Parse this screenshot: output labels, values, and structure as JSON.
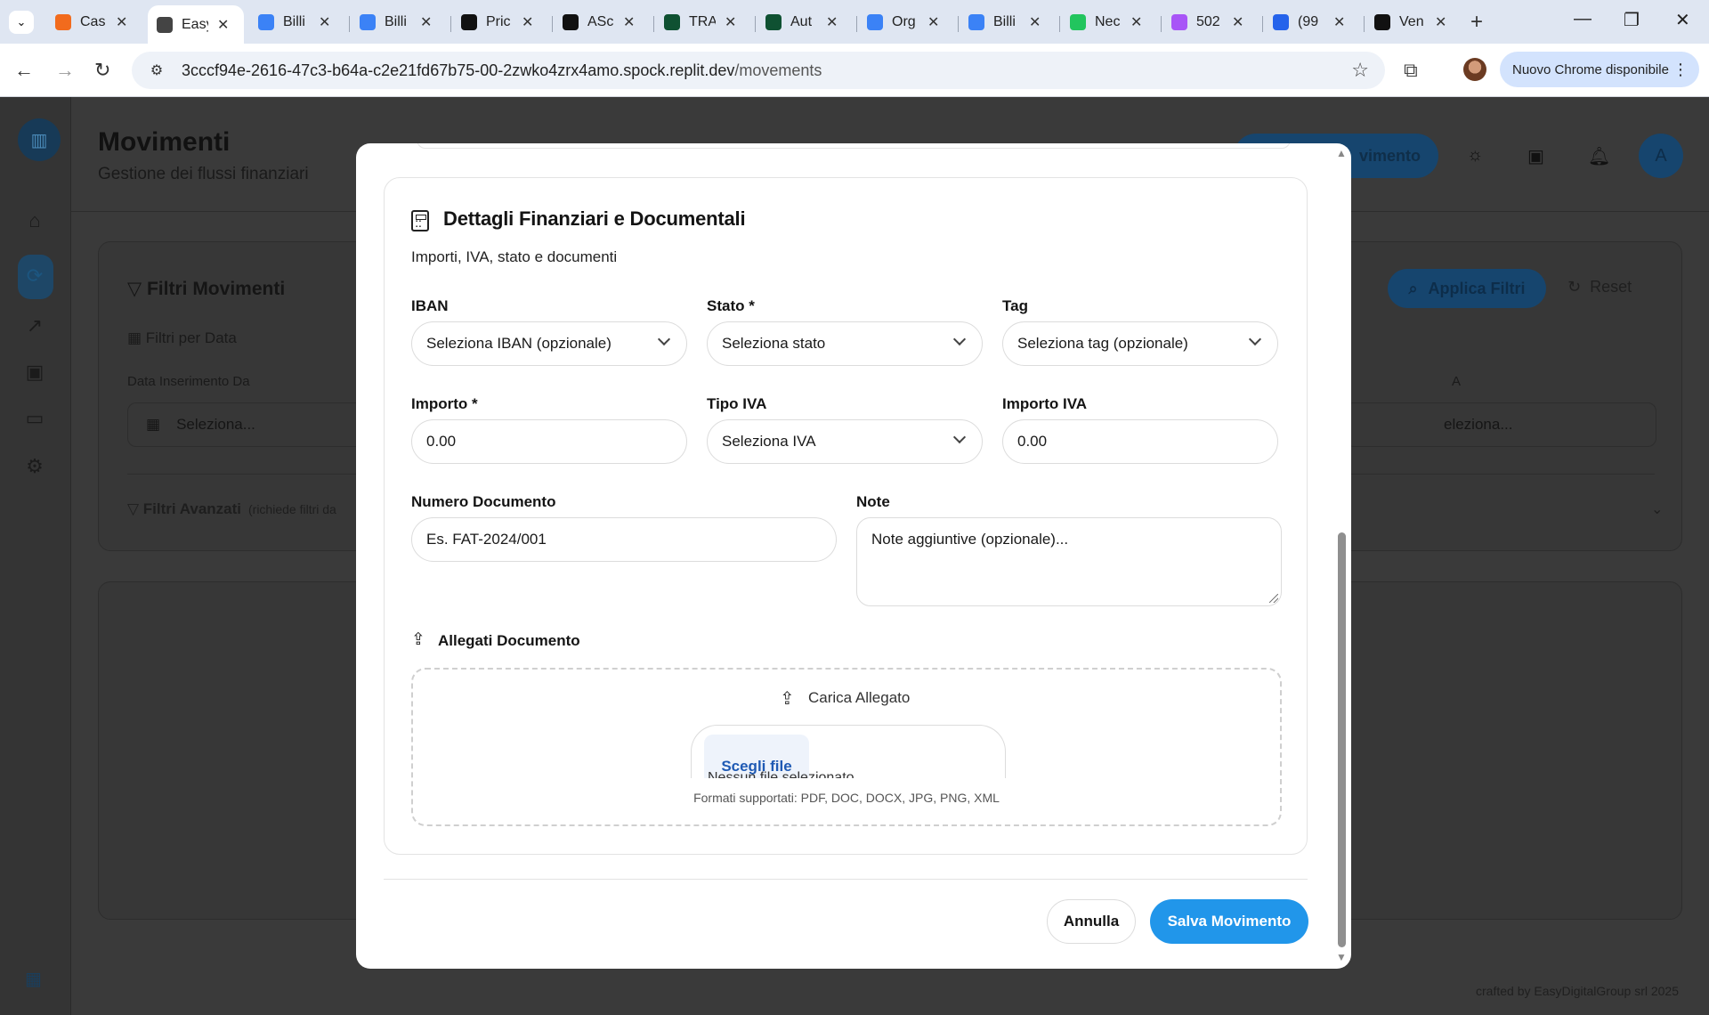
{
  "browser": {
    "tabs": [
      {
        "label": "Cas",
        "favicon_color": "#f26b1d",
        "active": false
      },
      {
        "label": "Easy",
        "favicon_color": "#444444",
        "active": true
      },
      {
        "label": "Billi",
        "favicon_color": "#3b82f6",
        "active": false
      },
      {
        "label": "Billi",
        "favicon_color": "#3b82f6",
        "active": false
      },
      {
        "label": "Pric",
        "favicon_color": "#111111",
        "active": false
      },
      {
        "label": "ASc",
        "favicon_color": "#111111",
        "active": false
      },
      {
        "label": "TRA",
        "favicon_color": "#0f5132",
        "active": false
      },
      {
        "label": "Aut",
        "favicon_color": "#0f5132",
        "active": false
      },
      {
        "label": "Org",
        "favicon_color": "#3b82f6",
        "active": false
      },
      {
        "label": "Billi",
        "favicon_color": "#3b82f6",
        "active": false
      },
      {
        "label": "Nec",
        "favicon_color": "#22c55e",
        "active": false
      },
      {
        "label": "502",
        "favicon_color": "#a855f7",
        "active": false
      },
      {
        "label": "(99",
        "favicon_color": "#2563eb",
        "active": false
      },
      {
        "label": "Ven",
        "favicon_color": "#111111",
        "active": false
      }
    ],
    "url_host": "3cccf94e-2616-47c3-b64a-c2e21fd67b75-00-2zwko4zrx4amo.spock.replit.dev",
    "url_path": "/movements",
    "update_label": "Nuovo Chrome disponibile"
  },
  "app": {
    "title": "Movimenti",
    "subtitle": "Gestione dei flussi finanziari",
    "new_button": "vimento",
    "avatar_initial": "A",
    "filters": {
      "title": "Filtri Movimenti",
      "date_section": "Filtri per Data",
      "date_from_label": "Data Inserimento Da",
      "date_from_placeholder": "Seleziona...",
      "date_to_label": "A",
      "date_to_placeholder": "eleziona...",
      "advanced_label": "Filtri Avanzati",
      "advanced_hint": "(richiede filtri da",
      "apply_label": "Applica Filtri",
      "reset_label": "Reset"
    },
    "footer": "crafted by EasyDigitalGroup srl 2025"
  },
  "modal": {
    "section_title": "Dettagli Finanziari e Documentali",
    "section_subtitle": "Importi, IVA, stato e documenti",
    "fields": {
      "iban": {
        "label": "IBAN",
        "value": "Seleziona IBAN (opzionale)"
      },
      "stato": {
        "label": "Stato *",
        "value": "Seleziona stato"
      },
      "tag": {
        "label": "Tag",
        "value": "Seleziona tag (opzionale)"
      },
      "importo": {
        "label": "Importo *",
        "value": "0.00"
      },
      "tipo_iva": {
        "label": "Tipo IVA",
        "value": "Seleziona IVA"
      },
      "importo_iva": {
        "label": "Importo IVA",
        "value": "0.00"
      },
      "numero_documento": {
        "label": "Numero Documento",
        "placeholder": "Es. FAT-2024/001"
      },
      "note": {
        "label": "Note",
        "placeholder": "Note aggiuntive (opzionale)..."
      }
    },
    "attachments": {
      "title": "Allegati Documento",
      "upload_label": "Carica Allegato",
      "choose_file": "Scegli file",
      "no_file": "Nessun file selezionato",
      "formats": "Formati supportati: PDF, DOC, DOCX, JPG, PNG, XML"
    },
    "actions": {
      "cancel": "Annulla",
      "save": "Salva Movimento"
    }
  }
}
